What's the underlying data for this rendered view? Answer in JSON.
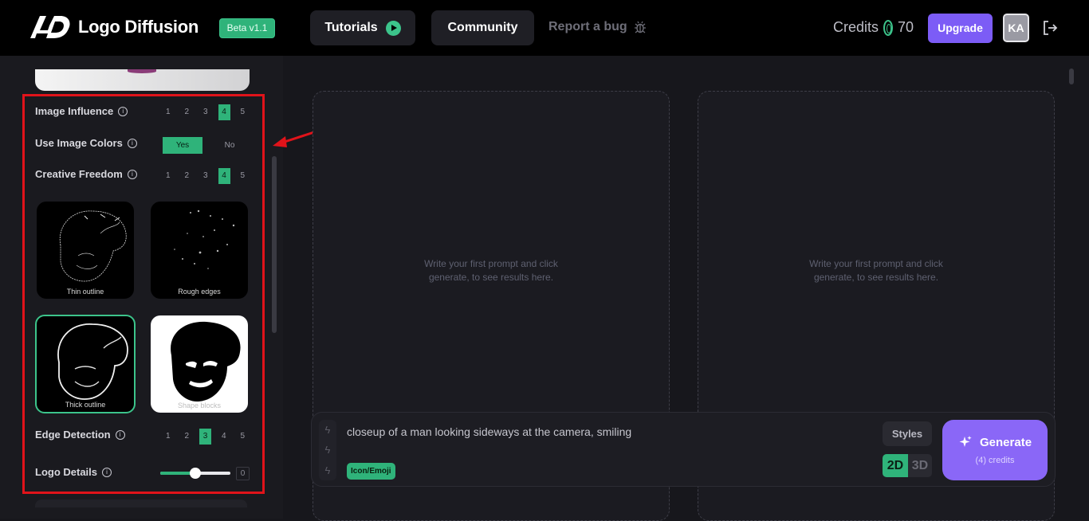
{
  "header": {
    "logo_text": "Logo Diffusion",
    "beta_badge": "Beta v1.1",
    "tutorials_label": "Tutorials",
    "community_label": "Community",
    "report_label": "Report a bug",
    "credits_label": "Credits",
    "credits_value": "70",
    "upgrade_label": "Upgrade",
    "avatar_initials": "KA"
  },
  "sidebar": {
    "image_influence": {
      "label": "Image Influence",
      "options": [
        "1",
        "2",
        "3",
        "4",
        "5"
      ],
      "selected": "4"
    },
    "use_image_colors": {
      "label": "Use Image Colors",
      "yes": "Yes",
      "no": "No",
      "selected": "Yes"
    },
    "creative_freedom": {
      "label": "Creative Freedom",
      "options": [
        "1",
        "2",
        "3",
        "4",
        "5"
      ],
      "selected": "4"
    },
    "tiles": [
      {
        "caption": "Thin outline"
      },
      {
        "caption": "Rough edges"
      },
      {
        "caption": "Thick outline",
        "selected": true
      },
      {
        "caption": "Shape blocks"
      }
    ],
    "edge_detection": {
      "label": "Edge Detection",
      "options": [
        "1",
        "2",
        "3",
        "4",
        "5"
      ],
      "selected": "3"
    },
    "logo_details": {
      "label": "Logo Details",
      "value": "0",
      "slider_fraction": 0.5
    }
  },
  "main": {
    "placeholder_left": "Write your first prompt and click generate, to see results here.",
    "placeholder_right": "Write your first prompt and click generate, to see results here."
  },
  "prompt": {
    "text": "closeup of a man looking sideways at the camera, smiling",
    "chip": "Icon/Emoji",
    "styles_label": "Styles",
    "mode_2d": "2D",
    "mode_3d": "3D",
    "generate_label": "Generate",
    "generate_cost": "(4) credits"
  },
  "colors": {
    "accent_green": "#2fb37a",
    "accent_purple": "#7c5cf6",
    "annotation_red": "#e0131a"
  }
}
